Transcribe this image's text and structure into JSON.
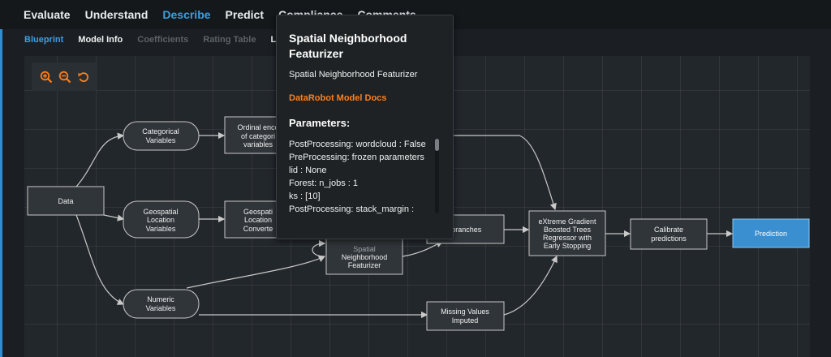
{
  "top_tabs": [
    {
      "label": "Evaluate"
    },
    {
      "label": "Understand"
    },
    {
      "label": "Describe",
      "active": true
    },
    {
      "label": "Predict"
    },
    {
      "label": "Compliance"
    },
    {
      "label": "Comments"
    }
  ],
  "sub_tabs": [
    {
      "label": "Blueprint",
      "active": true
    },
    {
      "label": "Model Info"
    },
    {
      "label": "Coefficients",
      "dim": true
    },
    {
      "label": "Rating Table",
      "dim": true
    },
    {
      "label": "Log"
    }
  ],
  "zoom_controls": {
    "icons": [
      "zoom-in-icon",
      "zoom-out-icon",
      "reset-icon"
    ],
    "color": "#ff7f1a"
  },
  "blueprint": {
    "nodes": {
      "data": "Data",
      "categorical": [
        "Categorical",
        "Variables"
      ],
      "geospatial": [
        "Geospatial",
        "Location",
        "Variables"
      ],
      "numeric": [
        "Numeric",
        "Variables"
      ],
      "ordinal": [
        "Ordinal enco",
        "of categori",
        "variables"
      ],
      "geo_convert": [
        "Geospati",
        "Location",
        "Converte"
      ],
      "spatial": [
        "Spatial",
        "Neighborhood",
        "Featurizer"
      ],
      "branches": "d branches",
      "missing": [
        "Missing Values",
        "Imputed"
      ],
      "xgb": [
        "eXtreme Gradient",
        "Boosted Trees",
        "Regressor with",
        "Early Stopping"
      ],
      "calibrate": [
        "Calibrate",
        "predictions"
      ],
      "prediction": "Prediction"
    },
    "colors": {
      "node_fill": "#2f3539",
      "node_stroke": "#c8c8c8",
      "edge": "#c9c9c9",
      "prediction_fill": "#3a8fd0"
    }
  },
  "tooltip": {
    "title": "Spatial Neighborhood Featurizer",
    "description": "Spatial Neighborhood Featurizer",
    "docs_link": "DataRobot Model Docs",
    "params_heading": "Parameters:",
    "params": [
      "PostProcessing: wordcloud : False",
      "PreProcessing: frozen parameters",
      "lid : None",
      "Forest: n_jobs : 1",
      "ks : [10]",
      "PostProcessing: stack_margin :"
    ]
  }
}
